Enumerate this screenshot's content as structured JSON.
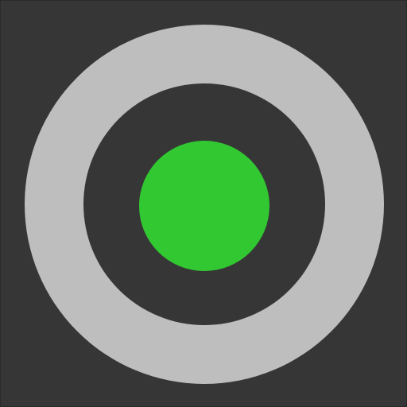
{
  "icon": {
    "name": "status-indicator-icon",
    "state": "active",
    "colors": {
      "background": "#363636",
      "ring": "#bebebe",
      "inner": "#363636",
      "dot": "#32c832"
    }
  }
}
